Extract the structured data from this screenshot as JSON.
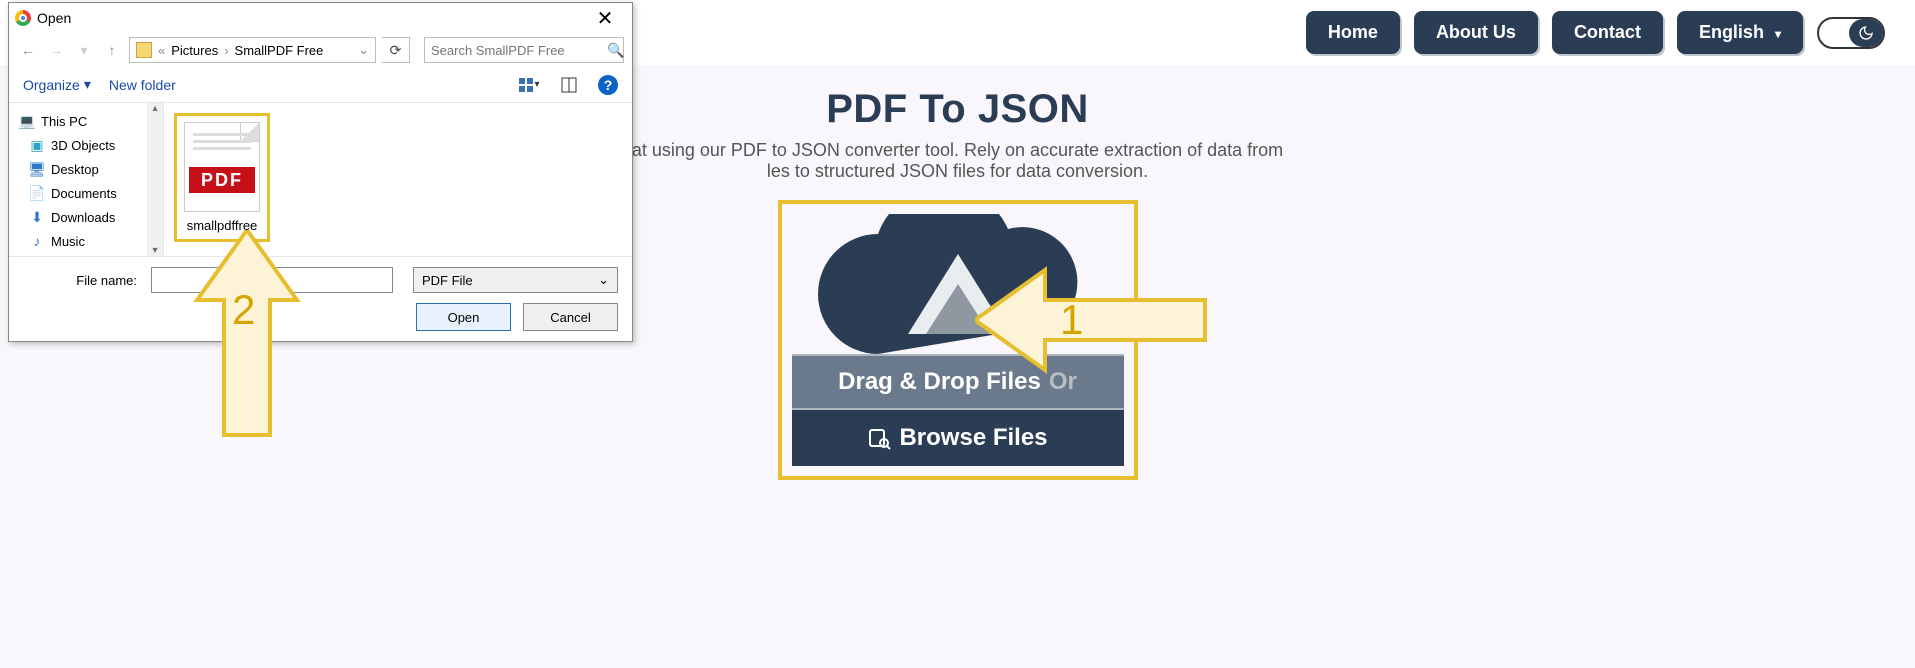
{
  "nav": {
    "home": "Home",
    "about": "About Us",
    "contact": "Contact",
    "lang": "English"
  },
  "page": {
    "title": "PDF To JSON",
    "subtitle_partial": "at using our PDF to JSON converter tool. Rely on accurate extraction of data from\nles to structured JSON files for data conversion.",
    "drag_text": "Drag & Drop Files",
    "drag_or": "Or",
    "browse": "Browse Files"
  },
  "annotations": {
    "arrow1": "1",
    "arrow2": "2"
  },
  "dialog": {
    "title": "Open",
    "breadcrumb": {
      "root_glyph": "«",
      "p1": "Pictures",
      "p2": "SmallPDF Free"
    },
    "search_placeholder": "Search SmallPDF Free",
    "toolbar": {
      "organize": "Organize",
      "newfolder": "New folder"
    },
    "tree": {
      "thispc": "This PC",
      "objects3d": "3D Objects",
      "desktop": "Desktop",
      "documents": "Documents",
      "downloads": "Downloads",
      "music": "Music"
    },
    "file": {
      "name": "smallpdffree",
      "badge": "PDF"
    },
    "filename_label": "File name:",
    "filename_value": "",
    "filetype": "PDF File",
    "open": "Open",
    "cancel": "Cancel"
  }
}
